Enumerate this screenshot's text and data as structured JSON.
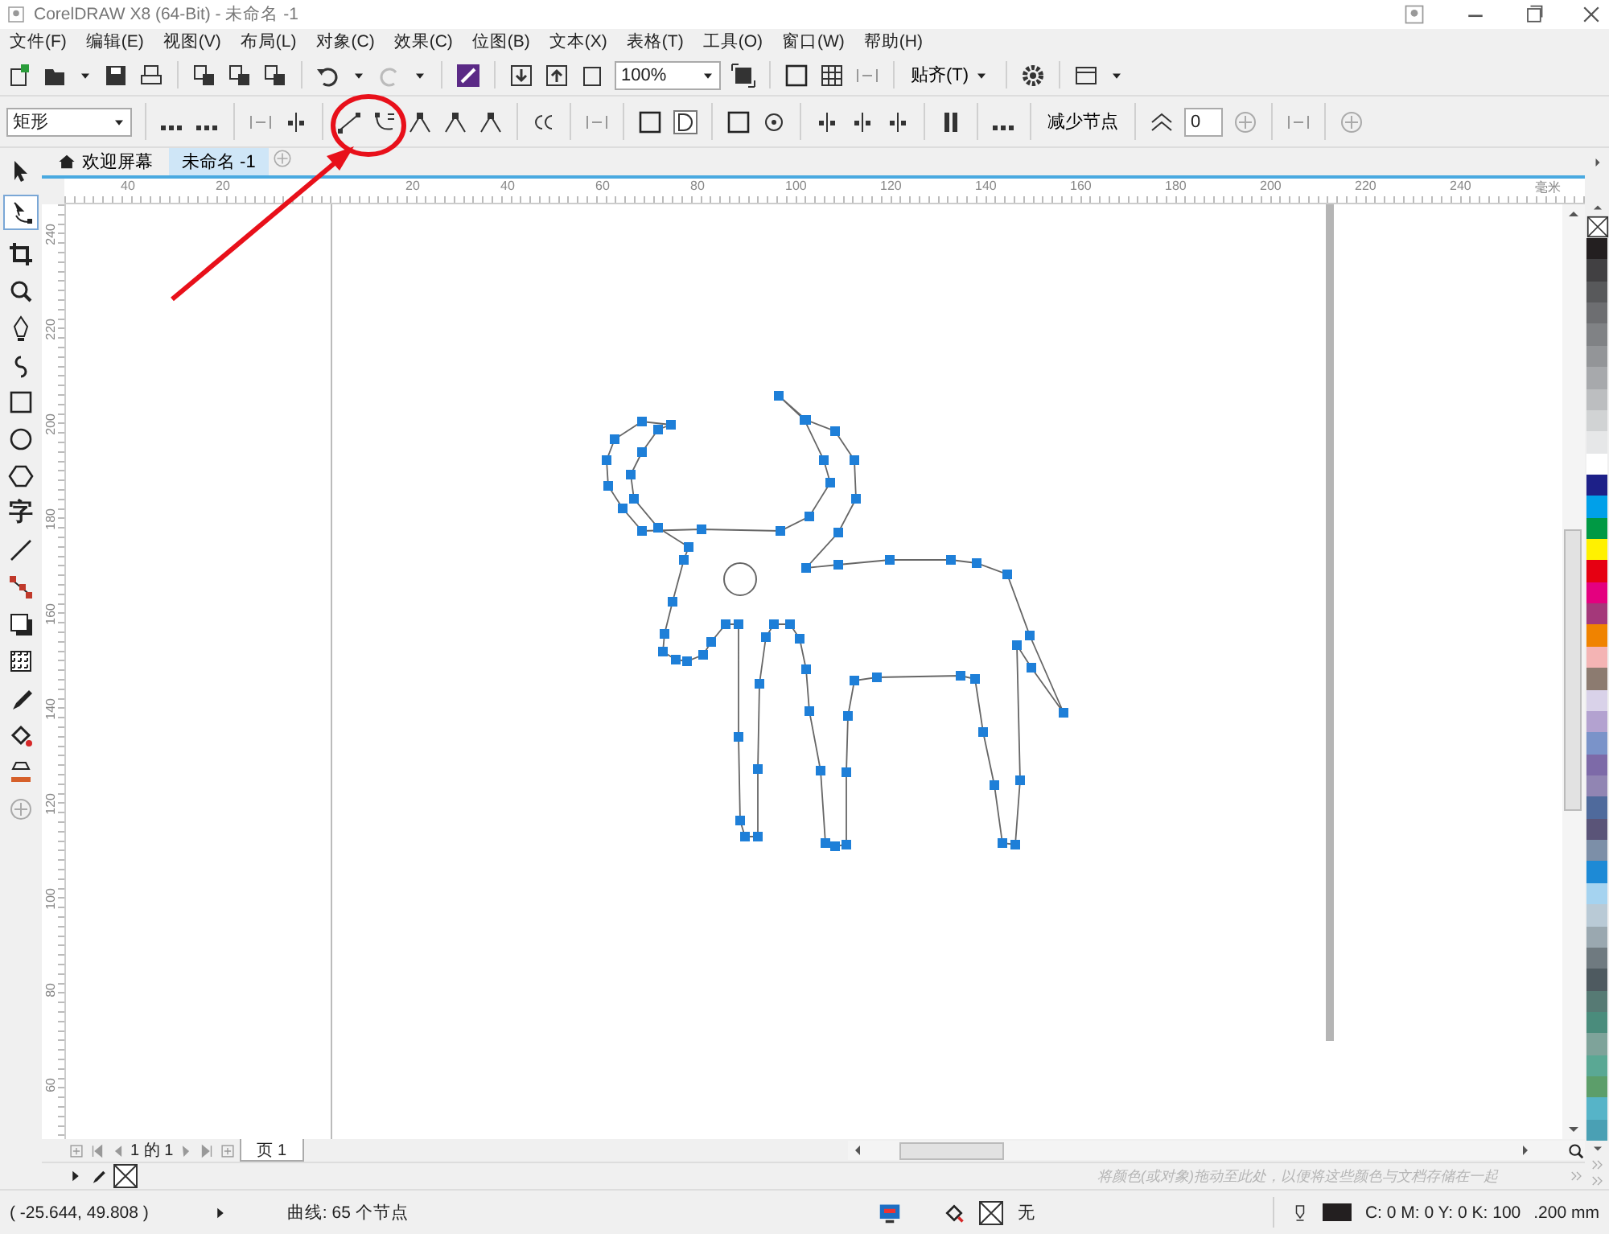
{
  "window": {
    "title": "CorelDRAW X8 (64-Bit) - 未命名 -1"
  },
  "menu": [
    "文件(F)",
    "编辑(E)",
    "视图(V)",
    "布局(L)",
    "对象(C)",
    "效果(C)",
    "位图(B)",
    "文本(X)",
    "表格(T)",
    "工具(O)",
    "窗口(W)",
    "帮助(H)"
  ],
  "toolbar": {
    "zoom": "100%",
    "snap": "贴齐(T)"
  },
  "property_bar": {
    "shape": "矩形",
    "reduce_nodes": "减少节点",
    "smoothness": "0"
  },
  "toolbox": {
    "text_tool_glyph": "字"
  },
  "doc_tabs": [
    {
      "label": "欢迎屏幕",
      "selected": false
    },
    {
      "label": "未命名 -1",
      "selected": true
    }
  ],
  "rulers": {
    "horizontal": [
      "40",
      "20",
      "20",
      "40",
      "60",
      "80",
      "100",
      "120",
      "140",
      "160",
      "180",
      "200",
      "220",
      "240"
    ],
    "unit": "毫米",
    "vertical": [
      "240",
      "220",
      "200",
      "180",
      "160",
      "140",
      "120",
      "100",
      "80",
      "60"
    ]
  },
  "page_nav": {
    "position": "1 的 1",
    "page_tab": "页 1"
  },
  "palette": {
    "hint": "将颜色(或对象)拖动至此处，以便将这些颜色与文档存储在一起",
    "colors": [
      {
        "color": "#231f20"
      },
      {
        "color": "#414042"
      },
      {
        "color": "#58595b"
      },
      {
        "color": "#6d6e71"
      },
      {
        "color": "#808285"
      },
      {
        "color": "#939598"
      },
      {
        "color": "#a7a9ac"
      },
      {
        "color": "#bcbec0"
      },
      {
        "color": "#d1d3d4"
      },
      {
        "color": "#e6e7e8"
      },
      {
        "color": "#ffffff"
      },
      {
        "color": "#1d2088"
      },
      {
        "color": "#00a0e9"
      },
      {
        "color": "#009944"
      },
      {
        "color": "#fff100"
      },
      {
        "color": "#e60012"
      },
      {
        "color": "#e4007f"
      },
      {
        "color": "#a4387a"
      },
      {
        "color": "#f08300"
      },
      {
        "color": "#f4b4b4"
      },
      {
        "color": "#8c7b70"
      },
      {
        "color": "#d9d2e9"
      },
      {
        "color": "#b3a2d0"
      },
      {
        "color": "#7a93c9"
      },
      {
        "color": "#7d6aa8"
      },
      {
        "color": "#9185b3"
      },
      {
        "color": "#4f6a9c"
      },
      {
        "color": "#5a5478"
      },
      {
        "color": "#7c8fa8"
      },
      {
        "color": "#1d8ad6"
      },
      {
        "color": "#a5d3f0"
      },
      {
        "color": "#b9cad6"
      },
      {
        "color": "#9aa8b0"
      },
      {
        "color": "#6f7a80"
      },
      {
        "color": "#4e5a60"
      },
      {
        "color": "#567a74"
      },
      {
        "color": "#4a8c7c"
      },
      {
        "color": "#7ea39a"
      },
      {
        "color": "#5aa894"
      },
      {
        "color": "#5c9e6a"
      },
      {
        "color": "#56b4c8"
      },
      {
        "color": "#4aa0b4"
      }
    ]
  },
  "status_bar": {
    "coordinates": "( -25.644, 49.808 )",
    "selection": "曲线: 65 个节点",
    "fill": "无",
    "outline": "C: 0 M: 0 Y: 0 K: 100",
    "outline_width": ".200 mm"
  }
}
